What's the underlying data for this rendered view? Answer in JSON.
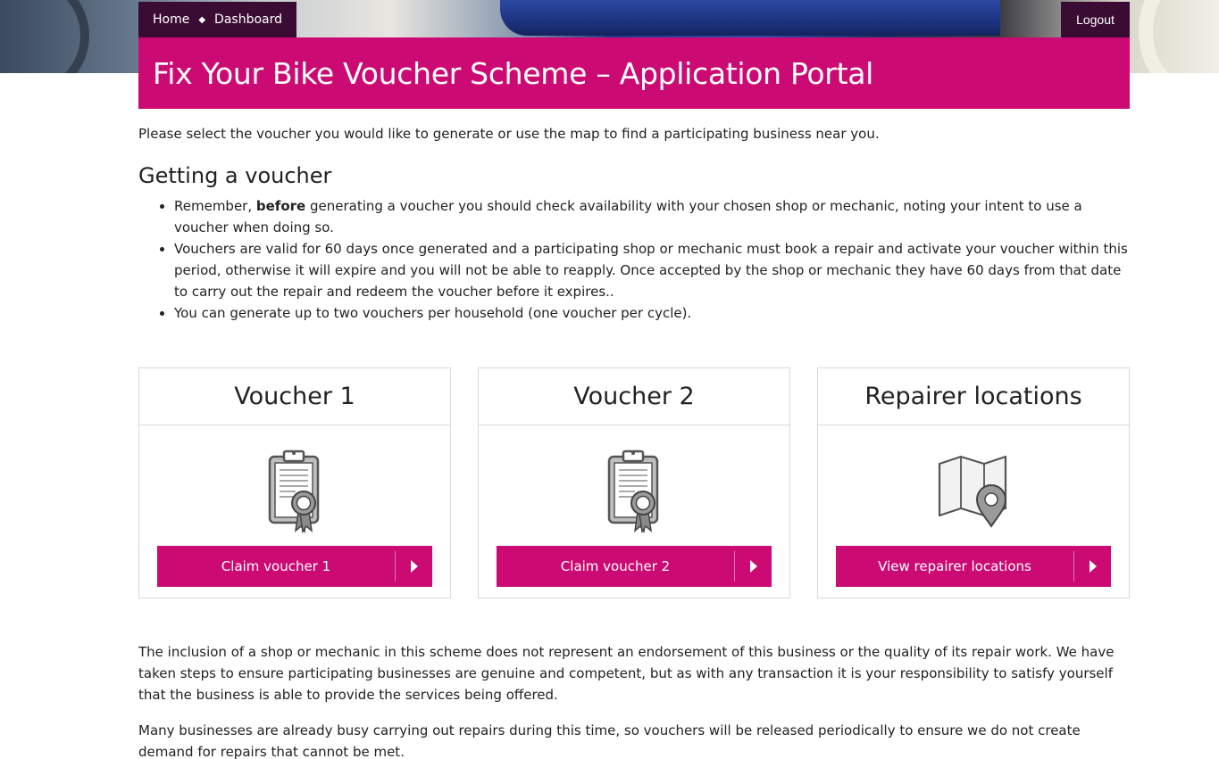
{
  "breadcrumb": {
    "home": "Home",
    "separator": "◆",
    "dashboard": "Dashboard"
  },
  "logout_label": "Logout",
  "page_title": "Fix Your Bike Voucher Scheme – Application Portal",
  "intro": "Please select the voucher you would like to generate or use the map to find a participating business near you.",
  "getting": {
    "heading": "Getting a voucher",
    "bullet1_pre": "Remember, ",
    "bullet1_bold": "before",
    "bullet1_post": " generating a voucher you should check availability with your chosen shop or mechanic, noting your intent to use a voucher when doing so.",
    "bullet2": "Vouchers are valid for 60 days once generated and a participating shop or mechanic must book a repair and activate your voucher within this period, otherwise it will expire and you will not be able to reapply. Once accepted by the shop or mechanic they have 60 days from that date to carry out the repair and redeem the voucher before it expires..",
    "bullet3": "You can generate up to two vouchers per household (one voucher per cycle)."
  },
  "cards": [
    {
      "title": "Voucher 1",
      "icon": "clipboard-certificate-icon",
      "button": "Claim voucher 1"
    },
    {
      "title": "Voucher 2",
      "icon": "clipboard-certificate-icon",
      "button": "Claim voucher 2"
    },
    {
      "title": "Repairer locations",
      "icon": "map-pin-icon",
      "button": "View repairer locations"
    }
  ],
  "disclaimer": [
    "The inclusion of a shop or mechanic in this scheme does not represent an endorsement of this business or the quality of its repair work. We have taken steps to ensure participating businesses are genuine and competent, but as with any transaction it is your responsibility to satisfy yourself that the business is able to provide the services being offered.",
    "Many businesses are already busy carrying out repairs during this time, so vouchers will be released periodically to ensure we do not create demand for repairs that cannot be met."
  ],
  "colors": {
    "brand": "#cc0a73",
    "dark": "#3a0c33"
  }
}
